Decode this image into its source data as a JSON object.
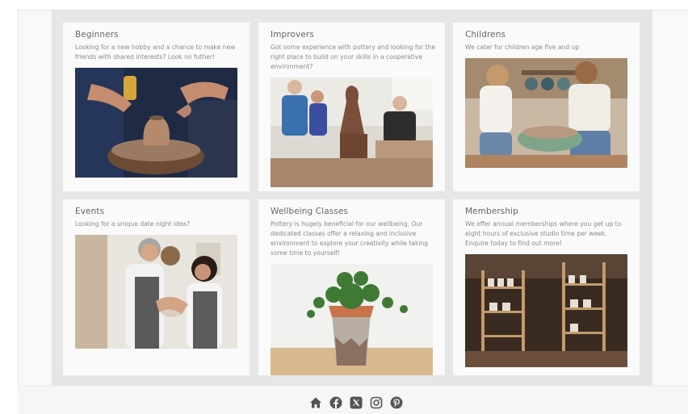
{
  "cards": [
    {
      "title": "Beginners",
      "description": "Looking for a new hobby and a chance to make new friends with shared interests? Look no futher!",
      "image": "hands-shaping-clay-vase-on-wheel"
    },
    {
      "title": "Improvers",
      "description": "Got some experience with pottery and looking for the right place to build on your skills in a cooperative environment?",
      "image": "group-around-clay-figure-sculpture"
    },
    {
      "title": "Childrens",
      "description": "We cater for children age five and up",
      "image": "two-children-working-clay-in-bowl"
    },
    {
      "title": "Events",
      "description": "Looking for a unique date night idea?",
      "image": "couple-shaping-clay-together"
    },
    {
      "title": "Wellbeing Classes",
      "description": "Pottery is hugely beneficial for our wellbeing. Our dedicated classes offer a relaxing and inclusive environment to explore your creativity while taking some time to yourself!",
      "image": "plant-in-handmade-pot"
    },
    {
      "title": "Membership",
      "description": "We offer annual memberships where you get up to eight hours of exclusive studio time per week. Enquire today to find out more!",
      "image": "studio-shelves-with-pottery"
    }
  ],
  "footer": {
    "icons": [
      "home-icon",
      "facebook-icon",
      "x-twitter-icon",
      "instagram-icon",
      "pinterest-icon"
    ],
    "icon_color": "#555555"
  }
}
